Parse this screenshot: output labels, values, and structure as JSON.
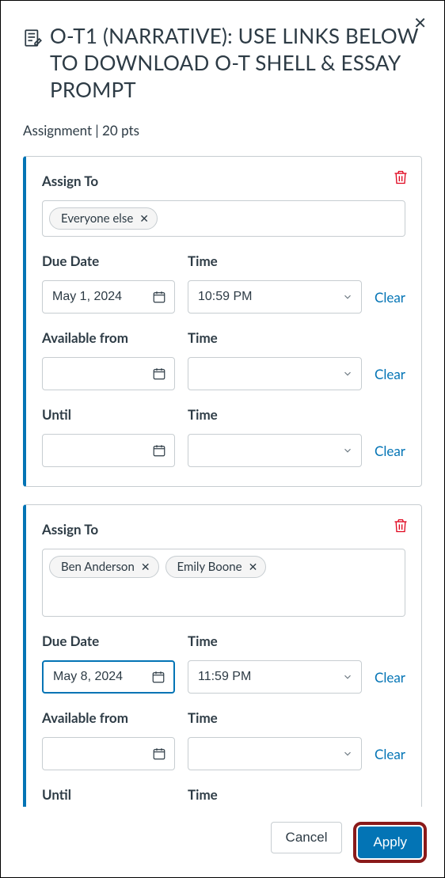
{
  "header": {
    "title": "O-T1 (NARRATIVE): USE LINKS BELOW TO DOWNLOAD O-T SHELL & ESSAY PROMPT",
    "subtitle": "Assignment | 20 pts"
  },
  "labels": {
    "assign_to": "Assign To",
    "due_date": "Due Date",
    "time": "Time",
    "available_from": "Available from",
    "until": "Until",
    "clear": "Clear"
  },
  "cards": [
    {
      "assignees": [
        "Everyone else"
      ],
      "tall_pillbox": false,
      "due": {
        "date": "May 1, 2024",
        "time": "10:59 PM",
        "focused": false
      },
      "from": {
        "date": "",
        "time": ""
      },
      "until": {
        "date": "",
        "time": ""
      },
      "show_until": true
    },
    {
      "assignees": [
        "Ben Anderson",
        "Emily Boone"
      ],
      "tall_pillbox": true,
      "due": {
        "date": "May 8, 2024",
        "time": "11:59 PM",
        "focused": true
      },
      "from": {
        "date": "",
        "time": ""
      },
      "until": {
        "date": "",
        "time": ""
      },
      "show_until": false
    }
  ],
  "footer": {
    "cancel": "Cancel",
    "apply": "Apply"
  }
}
